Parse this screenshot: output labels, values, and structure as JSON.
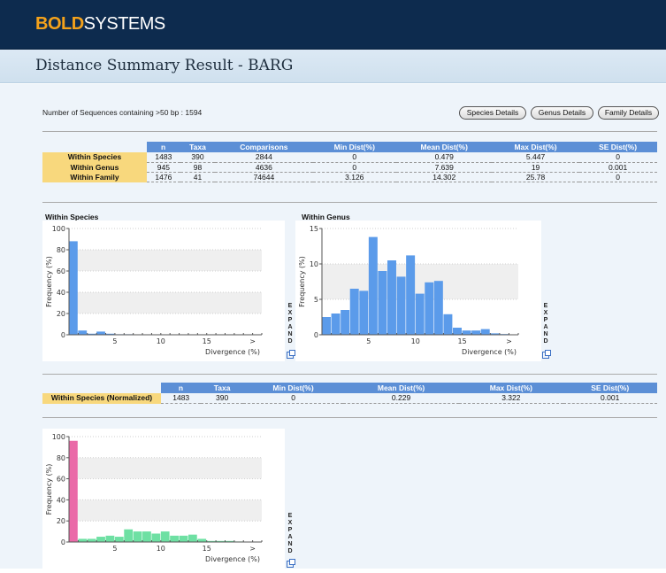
{
  "header": {
    "logo_bold": "BOLD",
    "logo_rest": "SYSTEMS",
    "page_title": "Distance Summary Result - BARG"
  },
  "summary": {
    "count_text": "Number of Sequences containing >50 bp : 1594"
  },
  "buttons": {
    "species": "Species Details",
    "genus": "Genus Details",
    "family": "Family Details"
  },
  "table1": {
    "headers": [
      "n",
      "Taxa",
      "Comparisons",
      "Min Dist(%)",
      "Mean Dist(%)",
      "Max Dist(%)",
      "SE Dist(%)"
    ],
    "rows": [
      {
        "label": "Within Species",
        "cells": [
          "1483",
          "390",
          "2844",
          "0",
          "0.479",
          "5.447",
          "0"
        ]
      },
      {
        "label": "Within Genus",
        "cells": [
          "945",
          "98",
          "4636",
          "0",
          "7.639",
          "19",
          "0.001"
        ]
      },
      {
        "label": "Within Family",
        "cells": [
          "1476",
          "41",
          "74644",
          "3.126",
          "14.302",
          "25.78",
          "0"
        ]
      }
    ]
  },
  "table2": {
    "headers": [
      "n",
      "Taxa",
      "Min Dist(%)",
      "Mean Dist(%)",
      "Max Dist(%)",
      "SE Dist(%)"
    ],
    "rows": [
      {
        "label": "Within Species (Normalized)",
        "cells": [
          "1483",
          "390",
          "0",
          "0.229",
          "3.322",
          "0.001"
        ]
      }
    ]
  },
  "charts": {
    "species_title": "Within Species",
    "genus_title": "Within Genus",
    "expand_label": "EXPAND"
  },
  "colors": {
    "bar_blue": "#5b9bea",
    "bar_pink": "#ea6aa8",
    "bar_green": "#6ee0a3",
    "header_blue": "#5c8fd6",
    "row_label_gold": "#f8d87d"
  },
  "chart_data": [
    {
      "type": "bar",
      "title": "Within Species",
      "ylabel": "Frequency (%)",
      "xlabel": "Divergence (%)",
      "ylim": [
        0,
        100
      ],
      "x_ticks": [
        "5",
        "10",
        "15",
        ">"
      ],
      "series": [
        {
          "values": [
            88,
            4,
            1,
            3,
            1,
            0.5,
            0.5,
            0.3,
            0.3,
            0.2,
            0.2,
            0.2,
            0.2,
            0.2,
            0.2,
            0.2,
            0.2
          ]
        }
      ]
    },
    {
      "type": "bar",
      "title": "Within Genus",
      "ylabel": "Frequency (%)",
      "xlabel": "Divergence (%)",
      "ylim": [
        0,
        15
      ],
      "x_ticks": [
        "5",
        "10",
        "15",
        ">"
      ],
      "series": [
        {
          "values": [
            2.5,
            3,
            3.5,
            6.5,
            6.2,
            13.8,
            9,
            10.5,
            8.2,
            11.2,
            5.8,
            7.4,
            7.6,
            2.9,
            1,
            0.6,
            0.6,
            0.8,
            0.2,
            0.1
          ]
        }
      ]
    },
    {
      "type": "bar",
      "title": "Within Species (Normalized)",
      "ylabel": "Frequency (%)",
      "xlabel": "Divergence (%)",
      "ylim": [
        0,
        100
      ],
      "x_ticks": [
        "5",
        "10",
        "15",
        ">"
      ],
      "series": [
        {
          "values": [
            96
          ],
          "color": "pink"
        },
        {
          "values": [
            0,
            3,
            3,
            5,
            6,
            5,
            12,
            10,
            10,
            8,
            10,
            6,
            6,
            7,
            3,
            1,
            1,
            1,
            0.5
          ],
          "color": "green"
        }
      ]
    }
  ]
}
